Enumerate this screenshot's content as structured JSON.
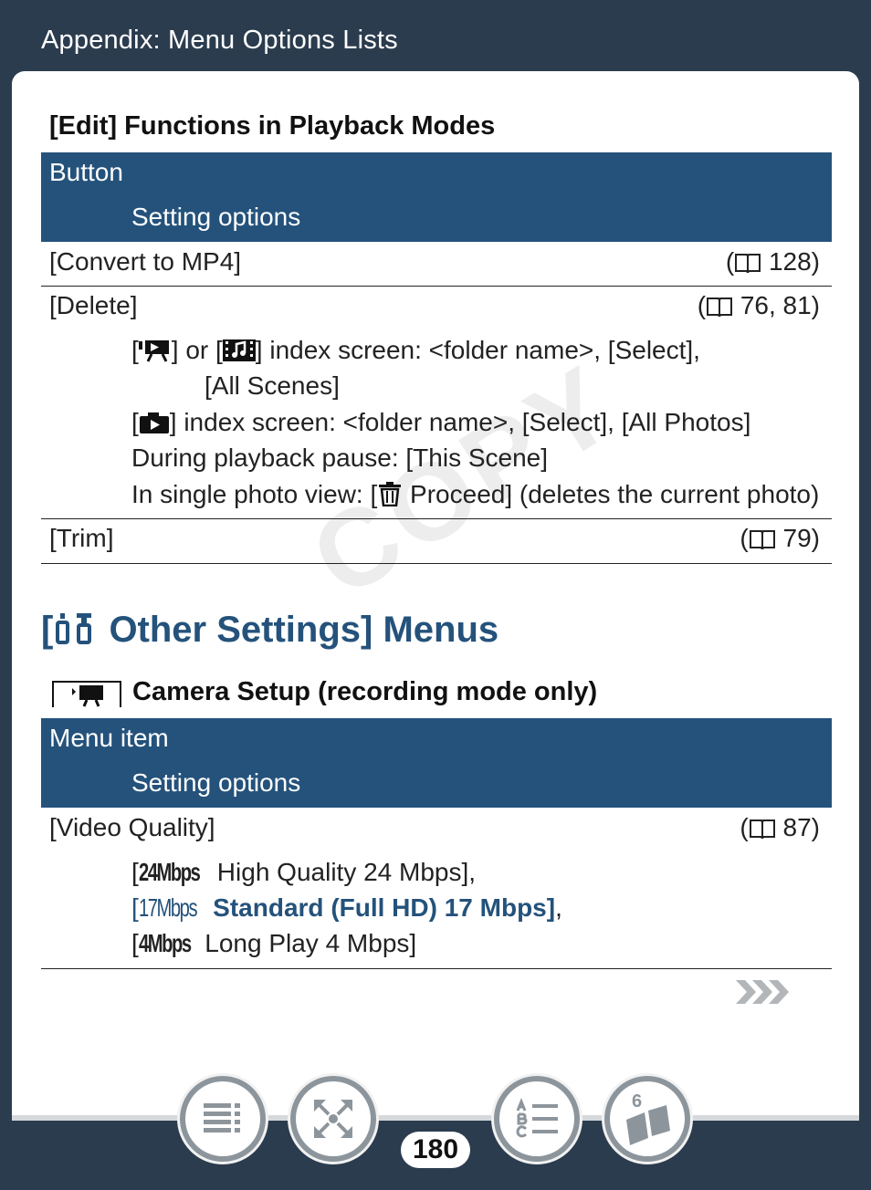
{
  "header": {
    "title": "Appendix: Menu Options Lists"
  },
  "edit_section": {
    "title": "[Edit] Functions in Playback Modes",
    "col1": "Button",
    "col2": "Setting options",
    "rows": [
      {
        "name": "[Convert to MP4]",
        "ref_open": "(",
        "ref_pages": " 128)"
      },
      {
        "name": "[Delete]",
        "ref_open": "(",
        "ref_pages": " 76, 81)"
      },
      {
        "name": "[Trim]",
        "ref_open": "(",
        "ref_pages": " 79)"
      }
    ],
    "delete_options": {
      "line1a": "[",
      "line1b": "] or [",
      "line1c": "] index screen: <folder name>, [Select],",
      "line2": "[All Scenes]",
      "line3a": "[",
      "line3b": "] index screen: <folder name>, [Select], [All Photos]",
      "line4": "During playback pause: [This Scene]",
      "line5a": "In single photo view: [",
      "line5b": " Proceed] (deletes the current photo)"
    }
  },
  "other_section": {
    "title_open": "[",
    "title_rest": " Other Settings] Menus",
    "subtitle": "Camera Setup (recording mode only)",
    "col1": "Menu item",
    "col2": "Setting options",
    "row": {
      "name": "[Video Quality]",
      "ref_open": "(",
      "ref_pages": " 87)"
    },
    "options": [
      {
        "open": "[",
        "badge": "24Mbps",
        "label": " High Quality 24 Mbps],",
        "default": false
      },
      {
        "open": "[",
        "badge": "17Mbps",
        "label": " Standard (Full HD) 17 Mbps]",
        "trail": ",",
        "default": true
      },
      {
        "open": "[",
        "badge": "4Mbps",
        "label": " Long Play 4 Mbps]",
        "default": false
      }
    ]
  },
  "watermark": "COPY",
  "footer": {
    "page_number": "180"
  },
  "colors": {
    "accent": "#24527b",
    "background": "#2b3c4e"
  },
  "icons": [
    "book-icon",
    "movie-mode-icon",
    "music-video-icon",
    "camera-icon",
    "trash-icon",
    "other-settings-icon",
    "video-camera-icon",
    "next-arrows-icon",
    "toc-icon",
    "index-icon",
    "glossary-icon",
    "bookmark-icon"
  ]
}
